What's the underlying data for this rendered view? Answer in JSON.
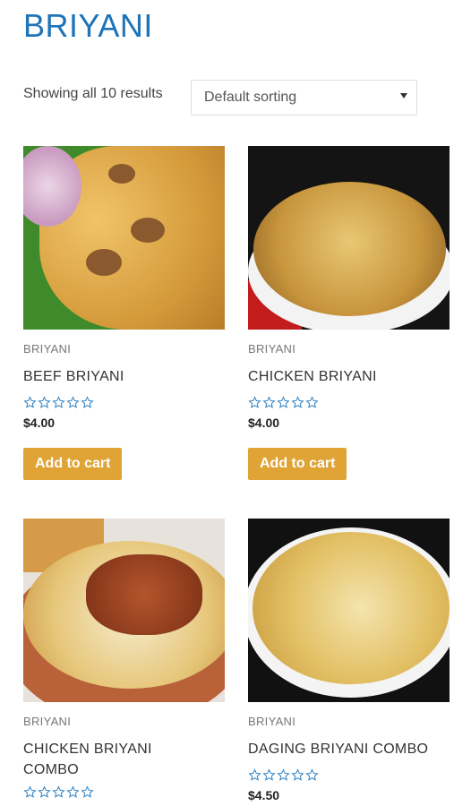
{
  "page": {
    "title": "BRIYANI",
    "results_text": "Showing all 10 results",
    "sort_value": "Default sorting"
  },
  "products": [
    {
      "category": "BRIYANI",
      "name": "BEEF BRIYANI",
      "price": "$4.00",
      "button": "Add to cart",
      "rating": 0,
      "image": "beef-briyani-photo"
    },
    {
      "category": "BRIYANI",
      "name": "CHICKEN BRIYANI",
      "price": "$4.00",
      "button": "Add to cart",
      "rating": 0,
      "image": "chicken-briyani-photo"
    },
    {
      "category": "BRIYANI",
      "name": "CHICKEN BRIYANI COMBO",
      "price": "",
      "button": "",
      "rating": 0,
      "image": "chicken-briyani-combo-photo"
    },
    {
      "category": "BRIYANI",
      "name": "DAGING BRIYANI COMBO",
      "price": "$4.50",
      "button": "",
      "rating": 0,
      "image": "daging-briyani-combo-photo"
    }
  ],
  "colors": {
    "title": "#1f73b7",
    "button_bg": "#e0a336",
    "star_outline": "#2a7fc2"
  }
}
